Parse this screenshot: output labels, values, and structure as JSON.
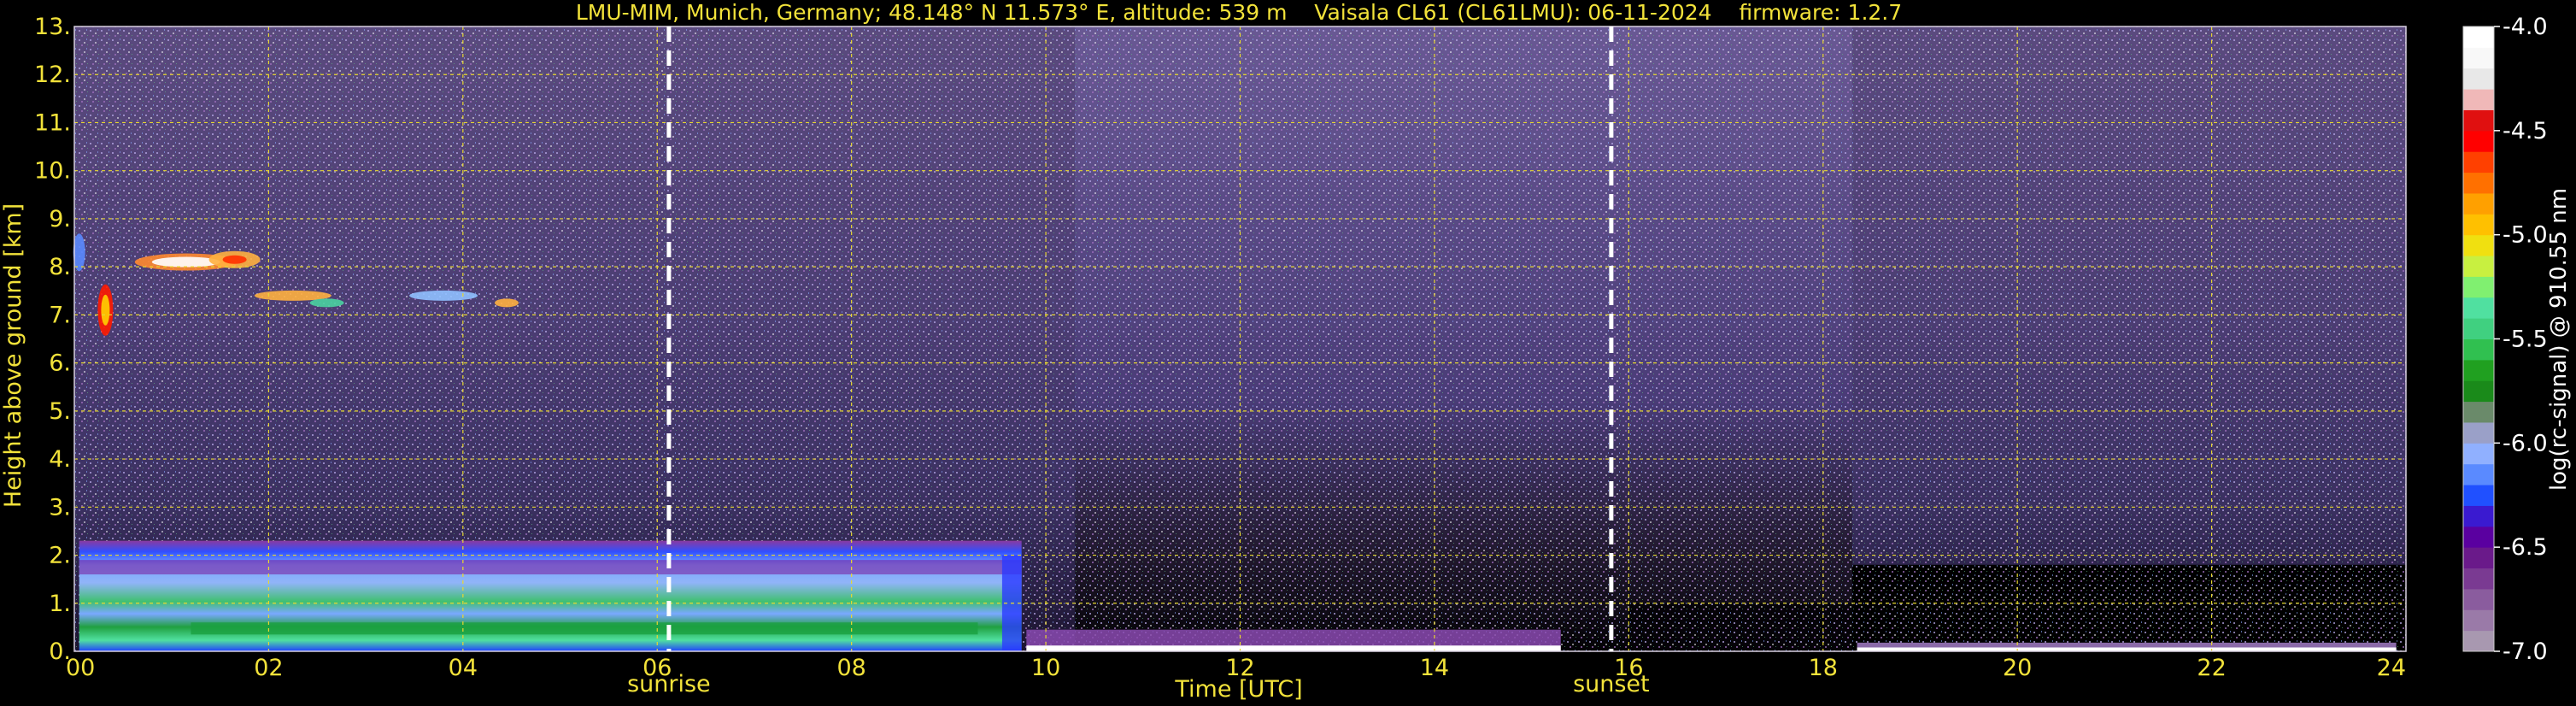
{
  "chart_data": {
    "type": "heatmap",
    "title": "LMU-MIM, Munich, Germany; 48.148° N 11.573° E, altitude: 539 m    Vaisala CL61 (CL61LMU): 06-11-2024    firmware: 1.2.7",
    "xlabel": "Time [UTC]",
    "ylabel": "Height above ground [km]",
    "xlim": [
      0,
      24
    ],
    "ylim": [
      0,
      13
    ],
    "x_ticks": [
      "00",
      "02",
      "04",
      "06",
      "08",
      "10",
      "12",
      "14",
      "16",
      "18",
      "20",
      "22",
      "24"
    ],
    "y_ticks": [
      "0.",
      "1.",
      "2.",
      "3.",
      "4.",
      "5.",
      "6.",
      "7.",
      "8.",
      "9.",
      "10.",
      "11.",
      "12.",
      "13."
    ],
    "grid": true,
    "markers": [
      {
        "label": "sunrise",
        "time": 6.12
      },
      {
        "label": "sunset",
        "time": 15.82
      }
    ],
    "colorbar": {
      "label": "log(rc-signal) @ 910.55 nm",
      "range": [
        -7.0,
        -4.0
      ],
      "ticks": [
        "-4.0",
        "-4.5",
        "-5.0",
        "-5.5",
        "-6.0",
        "-6.5",
        "-7.0"
      ],
      "colors": [
        "#a898b0",
        "#9a7aa8",
        "#8a5c9e",
        "#7a3a92",
        "#6a1a8a",
        "#5a00a0",
        "#3a1ad0",
        "#2050ff",
        "#5a8aff",
        "#90b0ff",
        "#9aa0c8",
        "#6a8a6a",
        "#1a8a1a",
        "#20a020",
        "#30c050",
        "#40d080",
        "#50e0a0",
        "#80f070",
        "#c8f040",
        "#f0e010",
        "#ffc000",
        "#ffa000",
        "#ff7000",
        "#ff4000",
        "#ff0000",
        "#e01010",
        "#f0b8b8",
        "#e8e8e8",
        "#f8f8f8",
        "#ffffff"
      ]
    },
    "features": [
      {
        "name": "boundary_layer",
        "t_start": 0.05,
        "t_end": 9.75,
        "top_km": 2.3
      },
      {
        "name": "cirrus",
        "t_start": 0.1,
        "t_end": 4.6,
        "base_km": 6.8,
        "top_km": 8.6
      },
      {
        "name": "low_layer",
        "t_start": 9.8,
        "t_end": 15.3,
        "top_km": 0.45
      }
    ]
  }
}
